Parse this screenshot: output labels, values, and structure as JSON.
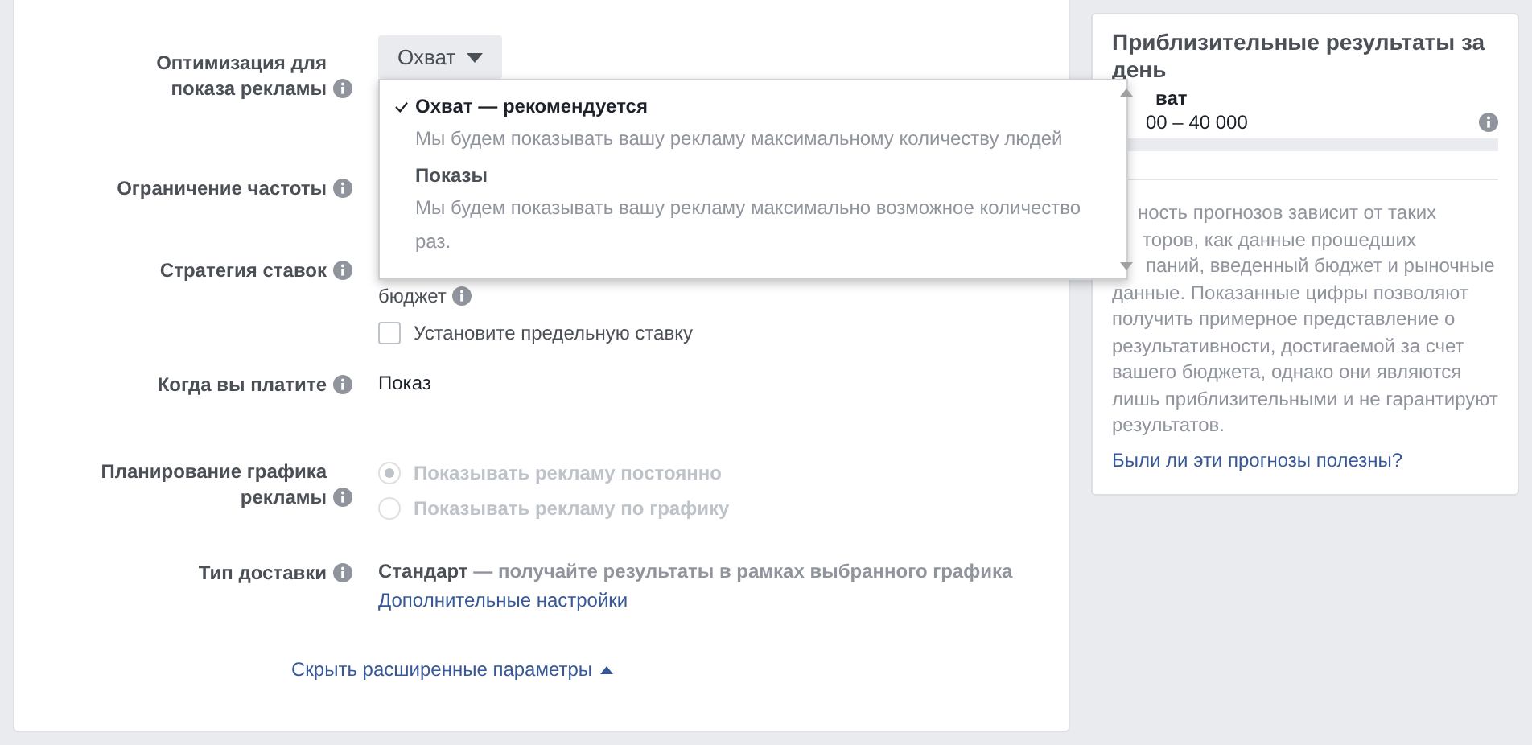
{
  "optimization": {
    "label": "Оптимизация для показа рекламы",
    "value": "Охват",
    "expanded": true,
    "options": [
      {
        "label": "Охват — рекомендуется",
        "description": "Мы будем показывать вашу рекламу максимальному количеству людей",
        "selected": true
      },
      {
        "label": "Показы",
        "description": "Мы будем показывать вашу рекламу максимально возможное количество раз.",
        "selected": false
      }
    ]
  },
  "frequency": {
    "label": "Ограничение частоты"
  },
  "bid_strategy": {
    "label": "Стратегия ставок",
    "value_tail": "бюджет",
    "bid_cap": {
      "label": "Установите предельную ставку",
      "checked": false
    }
  },
  "charge": {
    "label": "Когда вы платите",
    "value": "Показ"
  },
  "schedule": {
    "label": "Планирование графика рекламы",
    "disabled": true,
    "options": [
      {
        "label": "Показывать рекламу постоянно",
        "selected": true
      },
      {
        "label": "Показывать рекламу по графику",
        "selected": false
      }
    ]
  },
  "delivery": {
    "label": "Тип доставки",
    "value": "Стандарт",
    "description": "— получайте результаты в рамках выбранного графика",
    "link": "Дополнительные настройки"
  },
  "toggle_link": {
    "label": "Скрыть расширенные параметры",
    "expanded": true
  },
  "estimate": {
    "title": "Приблизительные результаты за день",
    "metric": "ват",
    "range": "00 – 40 000",
    "note_lines": [
      "ность прогнозов зависит от таких",
      "торов, как данные прошедших",
      "паний, введенный бюджет и рыночные"
    ],
    "note_rest": "данные. Показанные цифры позволяют получить примерное представление о результативности, достигаемой за счет вашего бюджета, однако они являются лишь приблизительными и не гарантируют результатов.",
    "link": "Были ли эти прогнозы полезны?"
  }
}
